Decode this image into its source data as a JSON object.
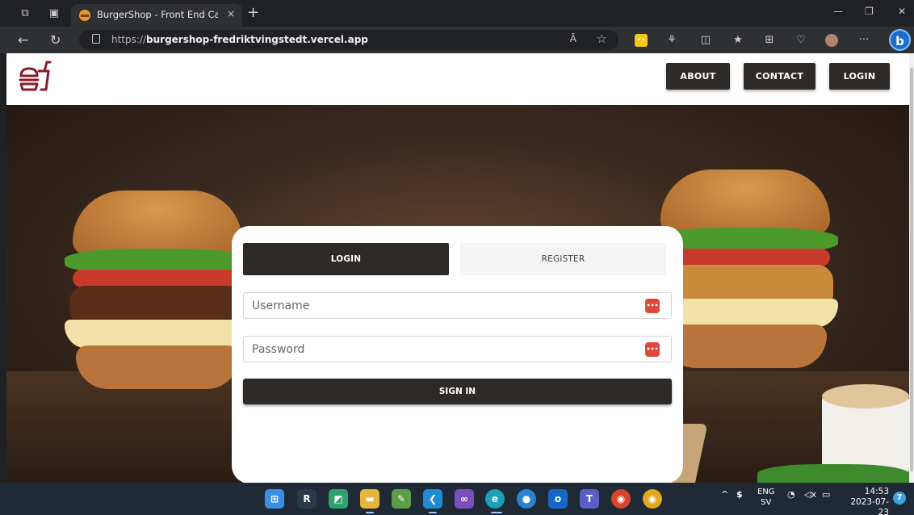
{
  "browser": {
    "tab_title": "BurgerShop - Front End Capston",
    "tab_close": "×",
    "new_tab": "+",
    "url_prefix": "https://",
    "url_host": "burgershop-fredriktvingstedt.vercel.app",
    "reader_label": "Ȃ",
    "more_label": "···",
    "bing_label": "b"
  },
  "site": {
    "nav": {
      "about": "ABOUT",
      "contact": "CONTACT",
      "login": "LOGIN"
    },
    "brand_color": "#8b1a2b",
    "button_color": "#2e2a28"
  },
  "login_form": {
    "tabs": {
      "login": "LOGIN",
      "register": "REGISTER"
    },
    "active_tab": "login",
    "username_placeholder": "Username",
    "password_placeholder": "Password",
    "submit_label": "SIGN IN",
    "password_manager_icon": "key-dots-icon"
  },
  "taskbar": {
    "lang_top": "ENG",
    "lang_bottom": "SV",
    "time": "14:53",
    "date": "2023-07-23",
    "notification_count": "7"
  }
}
